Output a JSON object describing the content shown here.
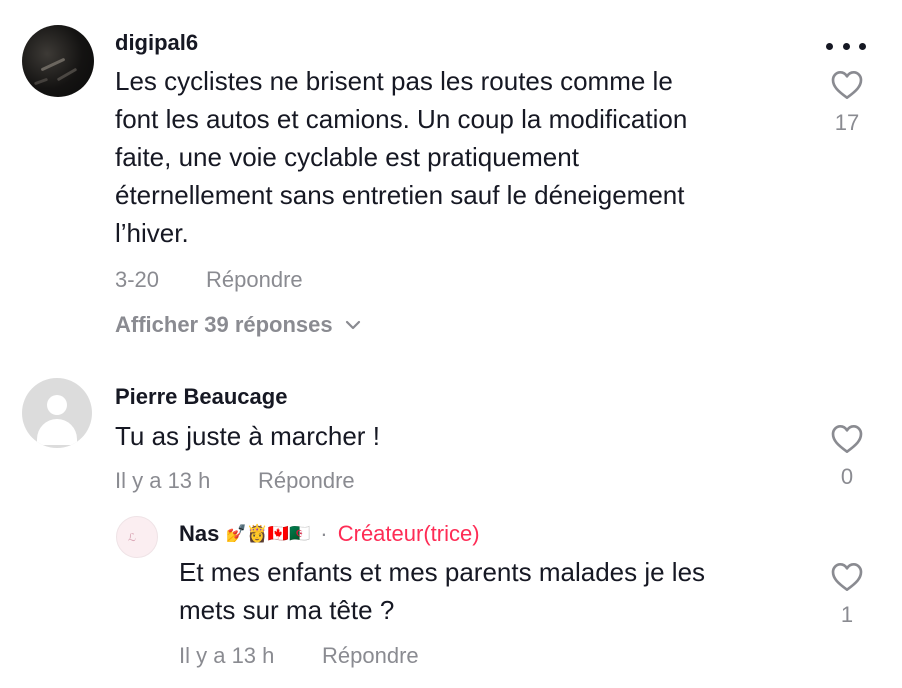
{
  "comments": [
    {
      "username": "digipal6",
      "text_lines": [
        "Les cyclistes ne brisent pas les routes comme le",
        "font les autos et camions. Un coup la modification",
        "faite, une voie cyclable est pratiquement",
        "éternellement sans entretien sauf le déneigement",
        "l’hiver."
      ],
      "date": "3-20",
      "reply_label": "Répondre",
      "likes": "17",
      "view_replies": "Afficher 39 réponses",
      "menu_icon": "more-dots-icon",
      "avatar_icon": "photo-avatar"
    },
    {
      "username": "Pierre Beaucage",
      "text": "Tu as juste à marcher !",
      "date": "Il y a 13 h",
      "reply_label": "Répondre",
      "likes": "0",
      "avatar_icon": "default-user-avatar"
    }
  ],
  "reply": {
    "username": "Nas",
    "emojis": "💅👸🇨🇦🇩🇿",
    "separator": "·",
    "badge": "Créateur(trice)",
    "text_lines": [
      "Et mes enfants et mes parents malades je les",
      "mets sur ma tête ?"
    ],
    "date": "Il y a 13 h",
    "reply_label": "Répondre",
    "likes": "1"
  },
  "colors": {
    "text": "#161823",
    "muted": "#8a8b91",
    "creator": "#fe2c55"
  }
}
